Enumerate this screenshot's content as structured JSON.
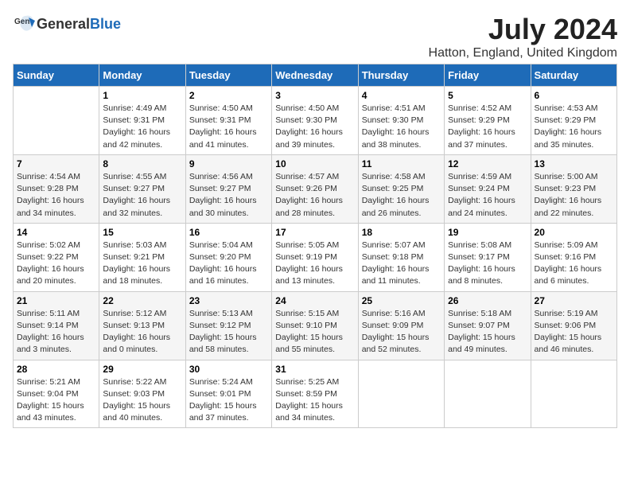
{
  "header": {
    "logo_general": "General",
    "logo_blue": "Blue",
    "month_year": "July 2024",
    "location": "Hatton, England, United Kingdom"
  },
  "days_of_week": [
    "Sunday",
    "Monday",
    "Tuesday",
    "Wednesday",
    "Thursday",
    "Friday",
    "Saturday"
  ],
  "weeks": [
    [
      {
        "day": "",
        "info": ""
      },
      {
        "day": "1",
        "info": "Sunrise: 4:49 AM\nSunset: 9:31 PM\nDaylight: 16 hours\nand 42 minutes."
      },
      {
        "day": "2",
        "info": "Sunrise: 4:50 AM\nSunset: 9:31 PM\nDaylight: 16 hours\nand 41 minutes."
      },
      {
        "day": "3",
        "info": "Sunrise: 4:50 AM\nSunset: 9:30 PM\nDaylight: 16 hours\nand 39 minutes."
      },
      {
        "day": "4",
        "info": "Sunrise: 4:51 AM\nSunset: 9:30 PM\nDaylight: 16 hours\nand 38 minutes."
      },
      {
        "day": "5",
        "info": "Sunrise: 4:52 AM\nSunset: 9:29 PM\nDaylight: 16 hours\nand 37 minutes."
      },
      {
        "day": "6",
        "info": "Sunrise: 4:53 AM\nSunset: 9:29 PM\nDaylight: 16 hours\nand 35 minutes."
      }
    ],
    [
      {
        "day": "7",
        "info": "Sunrise: 4:54 AM\nSunset: 9:28 PM\nDaylight: 16 hours\nand 34 minutes."
      },
      {
        "day": "8",
        "info": "Sunrise: 4:55 AM\nSunset: 9:27 PM\nDaylight: 16 hours\nand 32 minutes."
      },
      {
        "day": "9",
        "info": "Sunrise: 4:56 AM\nSunset: 9:27 PM\nDaylight: 16 hours\nand 30 minutes."
      },
      {
        "day": "10",
        "info": "Sunrise: 4:57 AM\nSunset: 9:26 PM\nDaylight: 16 hours\nand 28 minutes."
      },
      {
        "day": "11",
        "info": "Sunrise: 4:58 AM\nSunset: 9:25 PM\nDaylight: 16 hours\nand 26 minutes."
      },
      {
        "day": "12",
        "info": "Sunrise: 4:59 AM\nSunset: 9:24 PM\nDaylight: 16 hours\nand 24 minutes."
      },
      {
        "day": "13",
        "info": "Sunrise: 5:00 AM\nSunset: 9:23 PM\nDaylight: 16 hours\nand 22 minutes."
      }
    ],
    [
      {
        "day": "14",
        "info": "Sunrise: 5:02 AM\nSunset: 9:22 PM\nDaylight: 16 hours\nand 20 minutes."
      },
      {
        "day": "15",
        "info": "Sunrise: 5:03 AM\nSunset: 9:21 PM\nDaylight: 16 hours\nand 18 minutes."
      },
      {
        "day": "16",
        "info": "Sunrise: 5:04 AM\nSunset: 9:20 PM\nDaylight: 16 hours\nand 16 minutes."
      },
      {
        "day": "17",
        "info": "Sunrise: 5:05 AM\nSunset: 9:19 PM\nDaylight: 16 hours\nand 13 minutes."
      },
      {
        "day": "18",
        "info": "Sunrise: 5:07 AM\nSunset: 9:18 PM\nDaylight: 16 hours\nand 11 minutes."
      },
      {
        "day": "19",
        "info": "Sunrise: 5:08 AM\nSunset: 9:17 PM\nDaylight: 16 hours\nand 8 minutes."
      },
      {
        "day": "20",
        "info": "Sunrise: 5:09 AM\nSunset: 9:16 PM\nDaylight: 16 hours\nand 6 minutes."
      }
    ],
    [
      {
        "day": "21",
        "info": "Sunrise: 5:11 AM\nSunset: 9:14 PM\nDaylight: 16 hours\nand 3 minutes."
      },
      {
        "day": "22",
        "info": "Sunrise: 5:12 AM\nSunset: 9:13 PM\nDaylight: 16 hours\nand 0 minutes."
      },
      {
        "day": "23",
        "info": "Sunrise: 5:13 AM\nSunset: 9:12 PM\nDaylight: 15 hours\nand 58 minutes."
      },
      {
        "day": "24",
        "info": "Sunrise: 5:15 AM\nSunset: 9:10 PM\nDaylight: 15 hours\nand 55 minutes."
      },
      {
        "day": "25",
        "info": "Sunrise: 5:16 AM\nSunset: 9:09 PM\nDaylight: 15 hours\nand 52 minutes."
      },
      {
        "day": "26",
        "info": "Sunrise: 5:18 AM\nSunset: 9:07 PM\nDaylight: 15 hours\nand 49 minutes."
      },
      {
        "day": "27",
        "info": "Sunrise: 5:19 AM\nSunset: 9:06 PM\nDaylight: 15 hours\nand 46 minutes."
      }
    ],
    [
      {
        "day": "28",
        "info": "Sunrise: 5:21 AM\nSunset: 9:04 PM\nDaylight: 15 hours\nand 43 minutes."
      },
      {
        "day": "29",
        "info": "Sunrise: 5:22 AM\nSunset: 9:03 PM\nDaylight: 15 hours\nand 40 minutes."
      },
      {
        "day": "30",
        "info": "Sunrise: 5:24 AM\nSunset: 9:01 PM\nDaylight: 15 hours\nand 37 minutes."
      },
      {
        "day": "31",
        "info": "Sunrise: 5:25 AM\nSunset: 8:59 PM\nDaylight: 15 hours\nand 34 minutes."
      },
      {
        "day": "",
        "info": ""
      },
      {
        "day": "",
        "info": ""
      },
      {
        "day": "",
        "info": ""
      }
    ]
  ]
}
